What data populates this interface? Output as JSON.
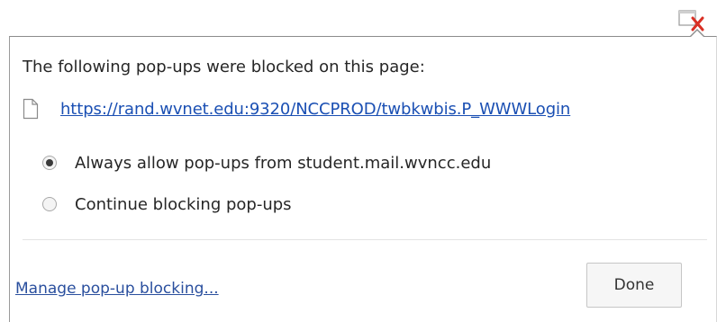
{
  "colors": {
    "link": "#1a4fb3",
    "blocked_x": "#d93025"
  },
  "toolbar": {
    "indicator_icon": "popup-blocked-icon"
  },
  "dialog": {
    "heading": "The following pop-ups were blocked on this page:",
    "blocked_popups": [
      {
        "icon": "page-icon",
        "url": "https://rand.wvnet.edu:9320/NCCPROD/twbkwbis.P_WWWLogin"
      }
    ],
    "options": [
      {
        "label": "Always allow pop-ups from student.mail.wvncc.edu",
        "selected": true
      },
      {
        "label": "Continue blocking pop-ups",
        "selected": false
      }
    ],
    "manage_link": "Manage pop-up blocking...",
    "done_label": "Done"
  }
}
